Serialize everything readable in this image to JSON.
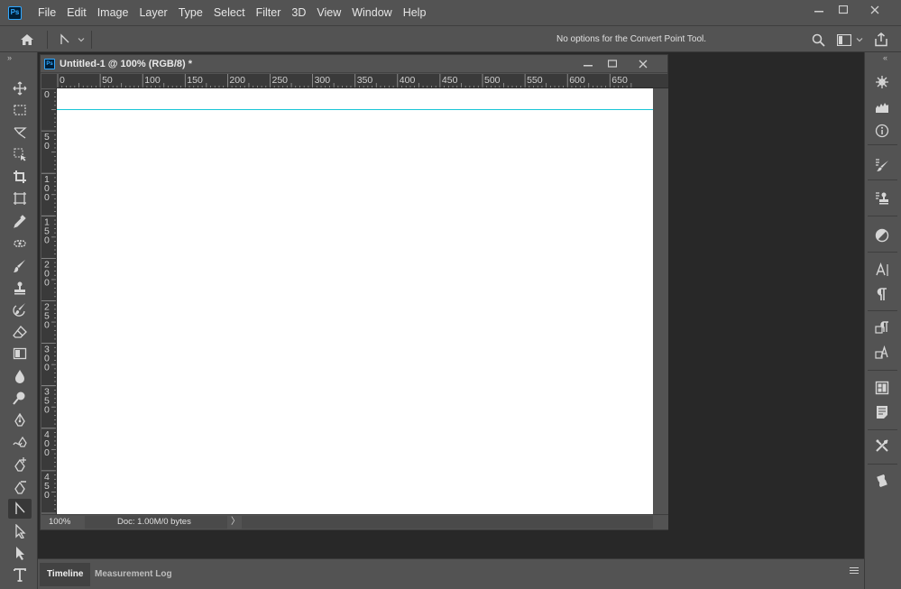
{
  "app": {
    "logo_text": "Ps",
    "menu": [
      "File",
      "Edit",
      "Image",
      "Layer",
      "Type",
      "Select",
      "Filter",
      "3D",
      "View",
      "Window",
      "Help"
    ],
    "window_controls": {
      "minimize": "—",
      "maximize": "☐",
      "close": "✕"
    }
  },
  "options_bar": {
    "message": "No options for the Convert Point Tool.",
    "home_icon": "home-icon",
    "tool_preset_icon": "convert-point-icon"
  },
  "toolbar": {
    "collapse": "»",
    "tools": [
      {
        "name": "move-tool",
        "icon": "move-icon"
      },
      {
        "name": "marquee-tool",
        "icon": "marquee-icon"
      },
      {
        "name": "lasso-tool",
        "icon": "lasso-icon"
      },
      {
        "name": "quick-select-tool",
        "icon": "quick-select-icon"
      },
      {
        "name": "crop-tool",
        "icon": "crop-icon"
      },
      {
        "name": "frame-tool",
        "icon": "frame-icon"
      },
      {
        "name": "eyedropper-tool",
        "icon": "eyedropper-icon"
      },
      {
        "name": "healing-tool",
        "icon": "healing-icon"
      },
      {
        "name": "brush-tool",
        "icon": "brush-icon"
      },
      {
        "name": "stamp-tool",
        "icon": "stamp-icon"
      },
      {
        "name": "history-brush-tool",
        "icon": "history-brush-icon"
      },
      {
        "name": "eraser-tool",
        "icon": "eraser-icon"
      },
      {
        "name": "gradient-tool",
        "icon": "gradient-icon"
      },
      {
        "name": "blur-tool",
        "icon": "blur-icon"
      },
      {
        "name": "dodge-tool",
        "icon": "dodge-icon"
      },
      {
        "name": "pen-tool",
        "icon": "pen-icon"
      },
      {
        "name": "freeform-pen-tool",
        "icon": "freeform-pen-icon"
      },
      {
        "name": "add-anchor-tool",
        "icon": "add-anchor-icon"
      },
      {
        "name": "delete-anchor-tool",
        "icon": "delete-anchor-icon"
      },
      {
        "name": "convert-point-tool",
        "icon": "convert-point-icon",
        "active": true
      },
      {
        "name": "path-select-tool",
        "icon": "path-select-icon"
      },
      {
        "name": "direct-select-tool",
        "icon": "direct-select-icon"
      },
      {
        "name": "type-tool",
        "icon": "type-icon"
      }
    ]
  },
  "document": {
    "title": "Untitled-1 @ 100% (RGB/8) *",
    "icon_text": "Ps",
    "controls": {
      "minimize": "—",
      "maximize": "☐",
      "close": "✕"
    },
    "hruler_labels": [
      "0",
      "50",
      "100",
      "150",
      "200",
      "250",
      "300",
      "350",
      "400",
      "450",
      "500",
      "550",
      "600",
      "650"
    ],
    "vruler_labels": [
      "0",
      "50",
      "100",
      "150",
      "200",
      "250",
      "300",
      "350",
      "400",
      "450"
    ],
    "status": {
      "zoom": "100%",
      "doc": "Doc: 1.00M/0 bytes",
      "arrow": "〉"
    },
    "colors": {
      "canvas": "#ffffff",
      "guide": "#19c6d6"
    }
  },
  "right_dock": {
    "collapse": "«",
    "panels": [
      {
        "name": "navigator",
        "icon": "navigator-icon"
      },
      {
        "name": "histogram",
        "icon": "histogram-icon"
      },
      {
        "name": "info",
        "icon": "info-icon"
      },
      {
        "name": "brush-settings",
        "icon": "brush-settings-icon"
      },
      {
        "name": "clone-source",
        "icon": "clone-source-icon"
      },
      {
        "name": "adjustments",
        "icon": "adjustments-icon"
      },
      {
        "name": "character",
        "icon": "character-icon"
      },
      {
        "name": "paragraph",
        "icon": "paragraph-icon"
      },
      {
        "name": "paragraph-styles",
        "icon": "paragraph-styles-icon"
      },
      {
        "name": "character-styles",
        "icon": "character-styles-icon"
      },
      {
        "name": "libraries",
        "icon": "libraries-icon"
      },
      {
        "name": "notes",
        "icon": "notes-icon"
      },
      {
        "name": "tool-presets",
        "icon": "tool-presets-icon"
      },
      {
        "name": "actions",
        "icon": "actions-icon"
      }
    ]
  },
  "bottom_panel": {
    "tabs": [
      {
        "label": "Timeline",
        "active": true
      },
      {
        "label": "Measurement Log",
        "active": false
      }
    ],
    "menu_icon": "panel-menu-icon"
  }
}
